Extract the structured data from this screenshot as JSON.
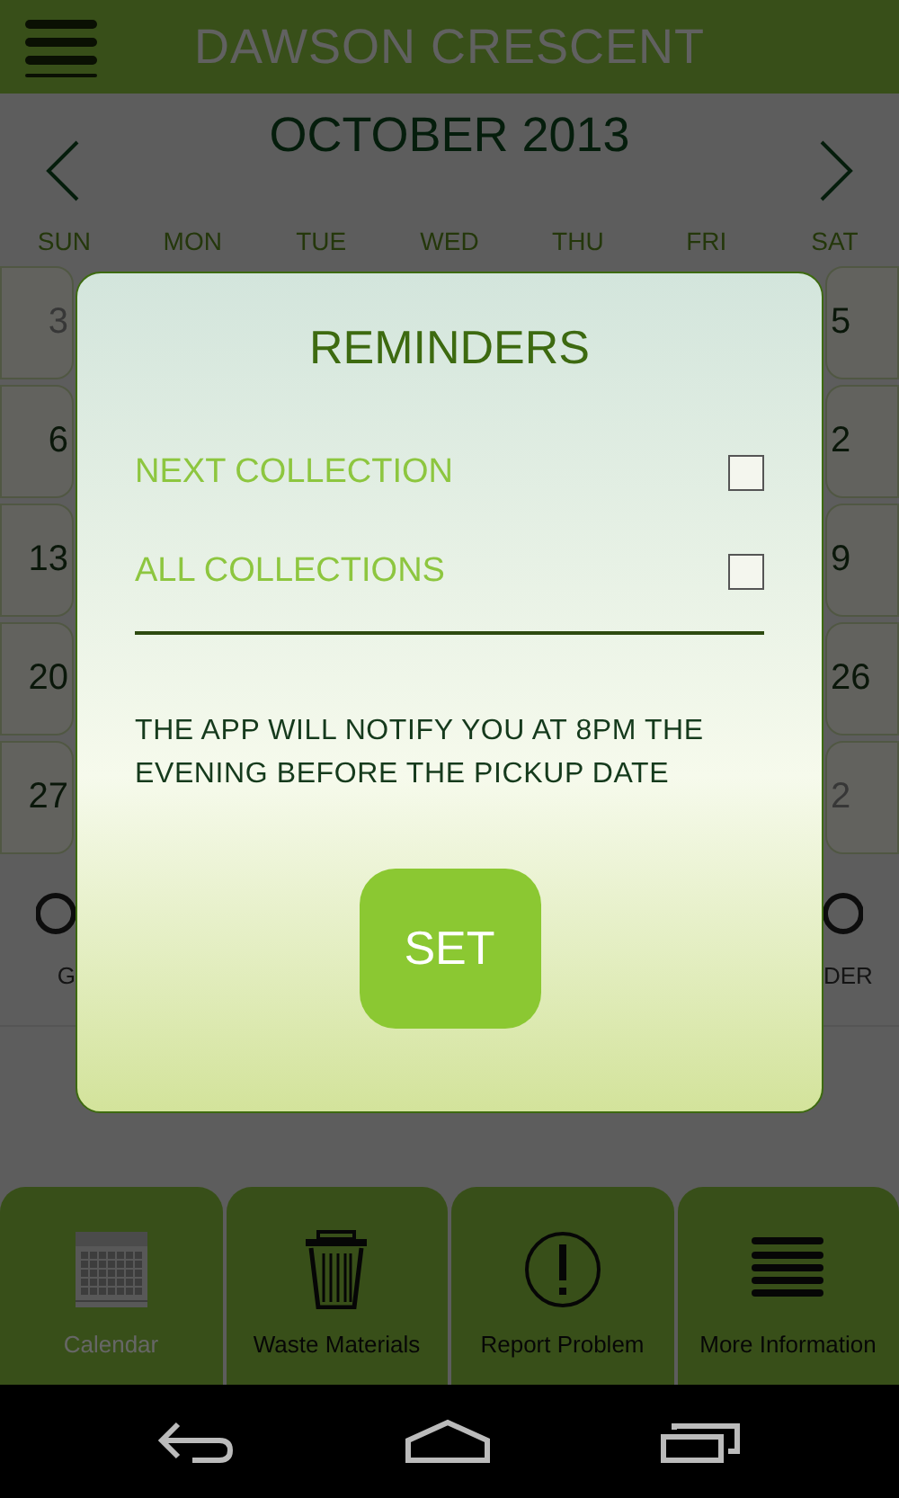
{
  "header": {
    "title": "DAWSON CRESCENT"
  },
  "calendar": {
    "month": "OCTOBER 2013",
    "weekdays": [
      "SUN",
      "MON",
      "TUE",
      "WED",
      "THU",
      "FRI",
      "SAT"
    ],
    "weeks": [
      {
        "first": {
          "day": "3",
          "muted": true
        },
        "last": {
          "day": "5",
          "muted": false
        }
      },
      {
        "first": {
          "day": "6",
          "muted": false
        },
        "last": {
          "day": "2",
          "muted": false
        }
      },
      {
        "first": {
          "day": "13",
          "muted": false
        },
        "last": {
          "day": "9",
          "muted": false
        }
      },
      {
        "first": {
          "day": "20",
          "muted": false
        },
        "last": {
          "day": "26",
          "muted": false
        }
      },
      {
        "first": {
          "day": "27",
          "muted": false
        },
        "last": {
          "day": "2",
          "muted": true
        }
      }
    ]
  },
  "legend": [
    {
      "label": "G"
    },
    {
      "label": "DER"
    }
  ],
  "dialog": {
    "title": "REMINDERS",
    "options": [
      {
        "label": "NEXT COLLECTION",
        "checked": false
      },
      {
        "label": "ALL COLLECTIONS",
        "checked": false
      }
    ],
    "note": "THE APP WILL NOTIFY YOU AT 8PM THE EVENING BEFORE THE PICKUP DATE",
    "button": "SET"
  },
  "tabs": [
    {
      "kind": "calendar",
      "label": "Calendar",
      "selected": true
    },
    {
      "kind": "trash",
      "label": "Waste Materials",
      "selected": false
    },
    {
      "kind": "alert",
      "label": "Report Problem",
      "selected": false
    },
    {
      "kind": "lines",
      "label": "More Information",
      "selected": false
    }
  ]
}
